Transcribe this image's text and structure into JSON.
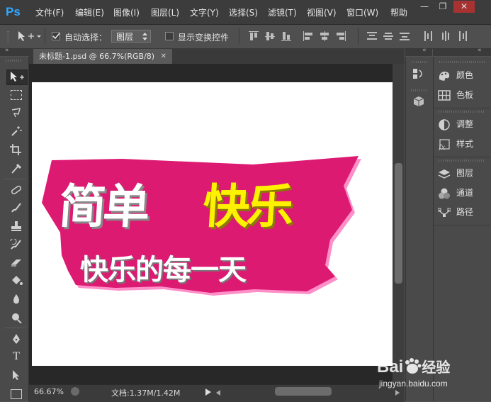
{
  "app": {
    "logo": "Ps"
  },
  "menu": [
    "文件(F)",
    "编辑(E)",
    "图像(I)",
    "图层(L)",
    "文字(Y)",
    "选择(S)",
    "滤镜(T)",
    "视图(V)",
    "窗口(W)",
    "帮助"
  ],
  "window_controls": {
    "minimize": "—",
    "restore": "❐",
    "close": "✕"
  },
  "options": {
    "auto_select_label": "自动选择：",
    "auto_select_checked": true,
    "auto_select_value": "图层",
    "show_transform_label": "显示变换控件",
    "show_transform_checked": false
  },
  "document": {
    "tab_title": "未标题-1.psd @ 66.7%(RGB/8)",
    "tab_close": "✕",
    "art_line1_white": "简单",
    "art_line1_yellow": "快乐",
    "art_line2": "快乐的每一天",
    "colors": {
      "badge": "#dc1a72",
      "yellow": "#fff200",
      "white": "#ffffff"
    }
  },
  "status": {
    "zoom": "66.67%",
    "doc_size": "文档:1.37M/1.42M"
  },
  "panels": [
    {
      "icon": "color-icon",
      "label": "颜色"
    },
    {
      "icon": "swatches-icon",
      "label": "色板"
    },
    {
      "icon": "adjustments-icon",
      "label": "调整"
    },
    {
      "icon": "styles-icon",
      "label": "样式"
    },
    {
      "icon": "layers-icon",
      "label": "图层"
    },
    {
      "icon": "channels-icon",
      "label": "通道"
    },
    {
      "icon": "paths-icon",
      "label": "路径"
    }
  ],
  "watermark": {
    "brand": "Bai",
    "brand2": "经验",
    "url": "jingyan.baidu.com"
  }
}
